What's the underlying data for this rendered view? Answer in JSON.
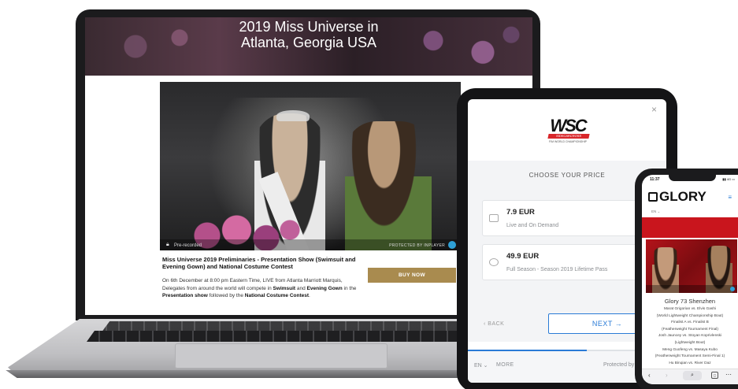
{
  "laptop": {
    "hero_title_line1": "2019 Miss Universe in",
    "hero_title_line2": "Atlanta, Georgia USA",
    "photo_lock_text": "Pre-recorded",
    "photo_protected_text": "PROTECTED BY INPLAYER",
    "event_title": "Miss Universe 2019 Preliminaries - Presentation Show (Swimsuit and Evening Gown) and National Costume Contest",
    "event_desc_part1": "On 6th December at 8:00 pm Eastern Time, LIVE from Atlanta Marriott Marquis, Delegates from around the world will compete in ",
    "event_desc_swimsuit": "Swimsuit",
    "event_desc_and": " and ",
    "event_desc_gown": "Evening Gown",
    "event_desc_part2": " in the ",
    "event_desc_presentation": "Presentation show",
    "event_desc_part3": " followed by the ",
    "event_desc_costume": "National Costume Contest",
    "event_desc_end": ".",
    "buy_label": "BUY NOW"
  },
  "tablet": {
    "close_glyph": "×",
    "logo_letters": "WSC",
    "logo_bar_text": "SIDECARCROSS",
    "logo_sub_text": "FIM WORLD CHAMPIONSHIP",
    "choose_title": "CHOOSE YOUR PRICE",
    "prices": [
      {
        "amount": "7.9 EUR",
        "desc": "Live and On Demand"
      },
      {
        "amount": "49.9 EUR",
        "desc": "Full Season - Season 2019 Lifetime Pass"
      }
    ],
    "back_label": "‹ BACK",
    "next_label": "NEXT →",
    "progress": 0.6,
    "lang_label": "EN ⌄",
    "more_label": "MORE",
    "protected_label": "Protected by"
  },
  "phone": {
    "status_time": "11:37",
    "status_right": "▮▮ 4G ▭",
    "logo_text": "GLORY",
    "menu_glyph": "≡",
    "lang_text": "EN ⌄",
    "event_title": "Glory 73 Shenzhen",
    "fights": [
      "Marat Grigorian vs. Elvis Gashi",
      "(World Lightweight Championship Bout)",
      "Finalist A vs. Finalist B",
      "(Featherweight Tournament Final)",
      "Josh Jauncey vs. Stoyan Koprivlenski",
      "(Lightweight Bout)",
      "Meng Guofeng vs. Masaya Kubo",
      "(Featherweight Tournament Semi-Final 1)",
      "Hu Binqian vs. River Daz"
    ],
    "browser_back": "‹",
    "browser_forward": "›",
    "browser_search": "⌕",
    "browser_tabs": "▢",
    "browser_more": "⋯"
  },
  "colors": {
    "buy_button": "#a98b4f",
    "next_button": "#2a7bd6",
    "glory_red": "#c9151d",
    "wsc_red": "#d8262a"
  }
}
